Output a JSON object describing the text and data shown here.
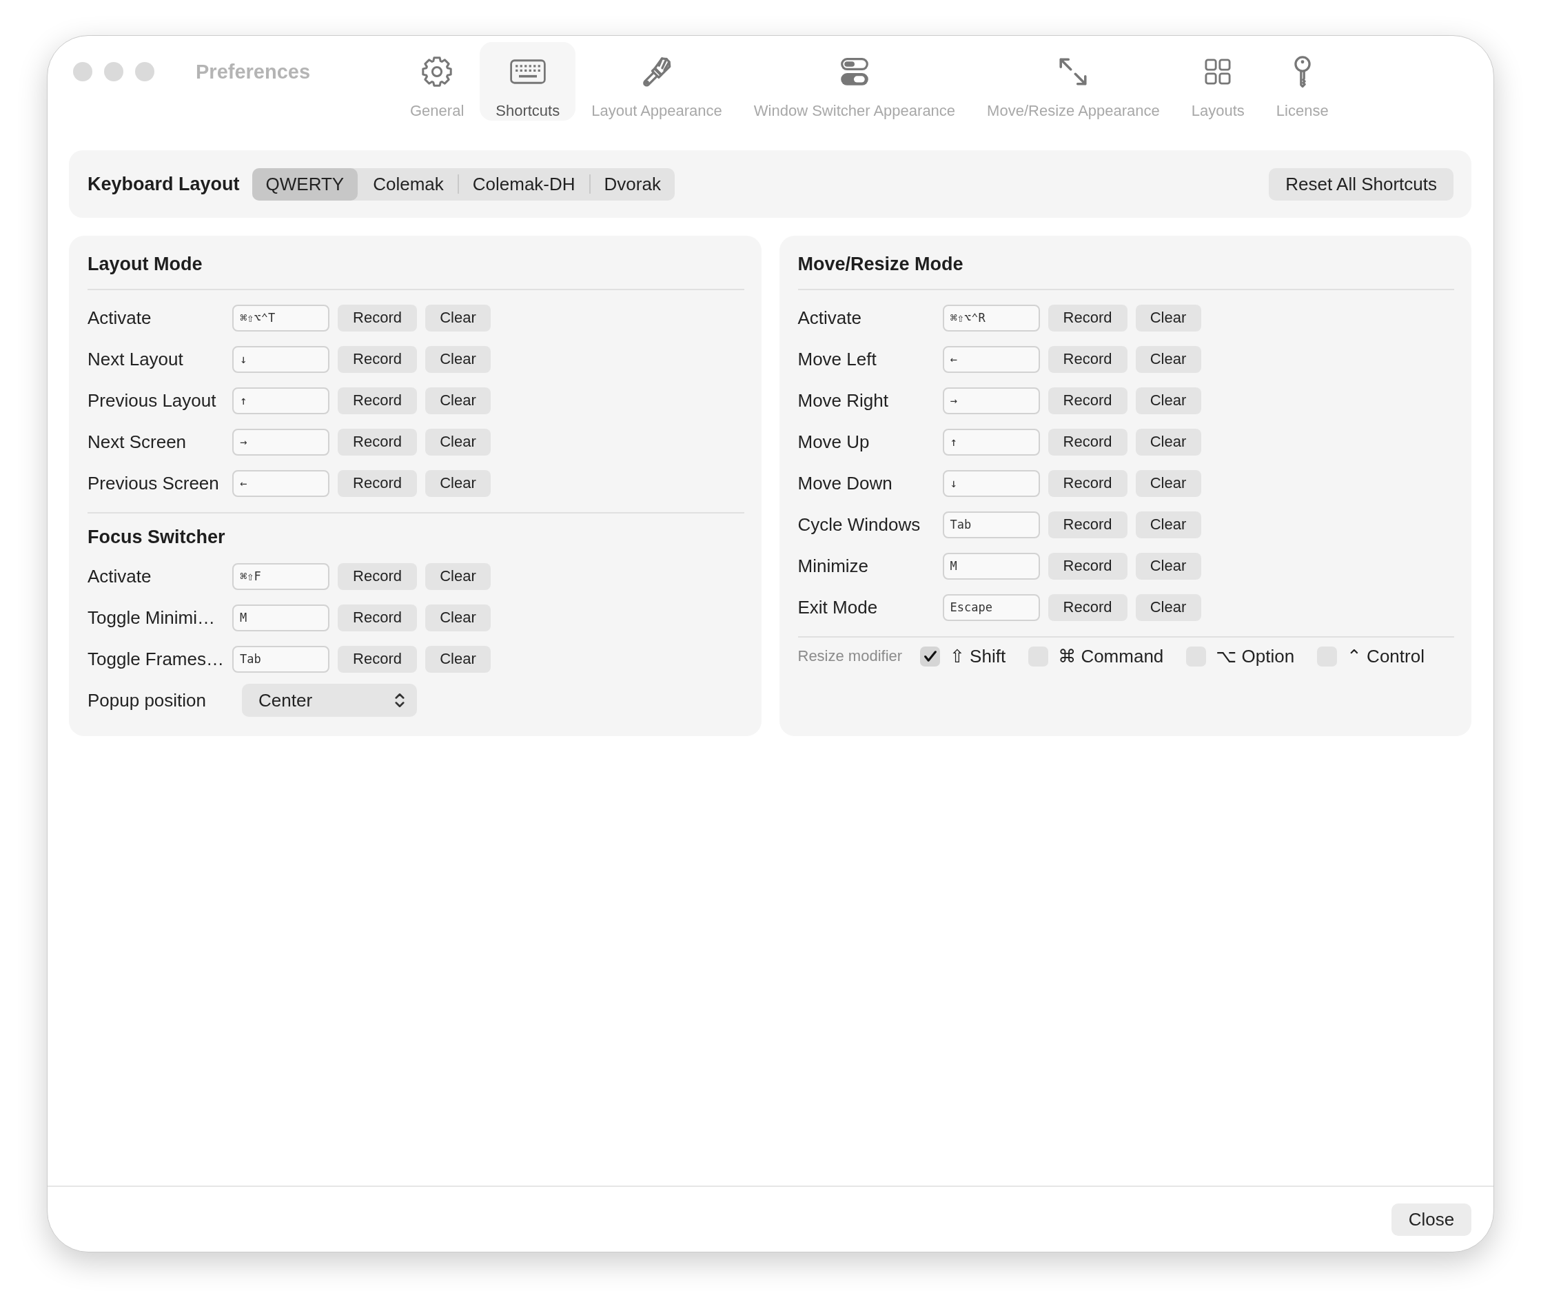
{
  "window": {
    "title": "Preferences"
  },
  "toolbar": {
    "tabs": [
      {
        "label": "General",
        "kind": "gear",
        "selected": false
      },
      {
        "label": "Shortcuts",
        "kind": "keyboard",
        "selected": true
      },
      {
        "label": "Layout Appearance",
        "kind": "brush",
        "selected": false
      },
      {
        "label": "Window Switcher Appearance",
        "kind": "toggles",
        "selected": false
      },
      {
        "label": "Move/Resize Appearance",
        "kind": "arrows",
        "selected": false
      },
      {
        "label": "Layouts",
        "kind": "grid",
        "selected": false
      },
      {
        "label": "License",
        "kind": "key",
        "selected": false
      }
    ]
  },
  "keyboard_layout": {
    "label": "Keyboard Layout",
    "options": [
      {
        "label": "QWERTY",
        "selected": true
      },
      {
        "label": "Colemak",
        "selected": false
      },
      {
        "label": "Colemak-DH",
        "selected": false
      },
      {
        "label": "Dvorak",
        "selected": false
      }
    ],
    "reset_button": "Reset All Shortcuts"
  },
  "panels": [
    {
      "sections": [
        {
          "title": "Layout Mode",
          "rows": [
            {
              "action": "Activate",
              "shortcut": "⌘⇧⌥⌃T",
              "record": "Record",
              "clear": "Clear"
            },
            {
              "action": "Next Layout",
              "shortcut": "↓",
              "record": "Record",
              "clear": "Clear"
            },
            {
              "action": "Previous Layout",
              "shortcut": "↑",
              "record": "Record",
              "clear": "Clear"
            },
            {
              "action": "Next Screen",
              "shortcut": "→",
              "record": "Record",
              "clear": "Clear"
            },
            {
              "action": "Previous Screen",
              "shortcut": "←",
              "record": "Record",
              "clear": "Clear"
            }
          ]
        },
        {
          "title": "Focus Switcher",
          "rows": [
            {
              "action": "Activate",
              "shortcut": "⌘⇧F",
              "record": "Record",
              "clear": "Clear"
            },
            {
              "action": "Toggle Minimi…",
              "shortcut": "M",
              "record": "Record",
              "clear": "Clear"
            },
            {
              "action": "Toggle Frames…",
              "shortcut": "Tab",
              "record": "Record",
              "clear": "Clear"
            }
          ],
          "popup": {
            "label": "Popup position",
            "value": "Center"
          }
        }
      ]
    },
    {
      "sections": [
        {
          "title": "Move/Resize Mode",
          "rows": [
            {
              "action": "Activate",
              "shortcut": "⌘⇧⌥⌃R",
              "record": "Record",
              "clear": "Clear"
            },
            {
              "action": "Move Left",
              "shortcut": "←",
              "record": "Record",
              "clear": "Clear"
            },
            {
              "action": "Move Right",
              "shortcut": "→",
              "record": "Record",
              "clear": "Clear"
            },
            {
              "action": "Move Up",
              "shortcut": "↑",
              "record": "Record",
              "clear": "Clear"
            },
            {
              "action": "Move Down",
              "shortcut": "↓",
              "record": "Record",
              "clear": "Clear"
            },
            {
              "action": "Cycle Windows",
              "shortcut": "Tab",
              "record": "Record",
              "clear": "Clear"
            },
            {
              "action": "Minimize",
              "shortcut": "M",
              "record": "Record",
              "clear": "Clear"
            },
            {
              "action": "Exit Mode",
              "shortcut": "Escape",
              "record": "Record",
              "clear": "Clear"
            }
          ]
        }
      ],
      "modifiers": {
        "label": "Resize modifier",
        "options": [
          {
            "label": "⇧ Shift",
            "checked": true
          },
          {
            "label": "⌘ Command",
            "checked": false
          },
          {
            "label": "⌥ Option",
            "checked": false
          },
          {
            "label": "⌃ Control",
            "checked": false
          }
        ]
      }
    }
  ],
  "footer": {
    "close_button": "Close"
  }
}
